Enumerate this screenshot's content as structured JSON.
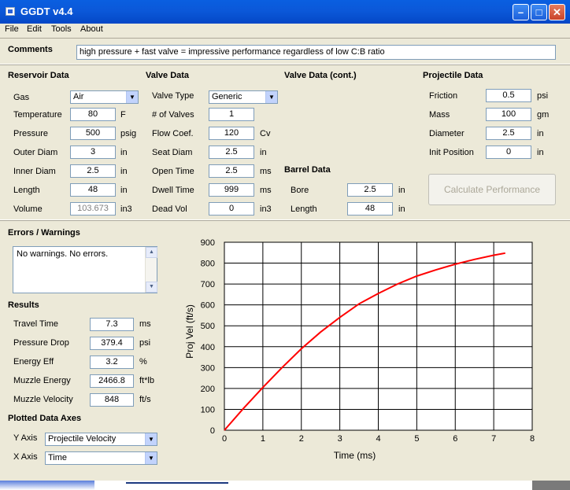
{
  "window": {
    "title": "GGDT v4.4"
  },
  "menu": [
    "File",
    "Edit",
    "Tools",
    "About"
  ],
  "comments": {
    "label": "Comments",
    "value": "high pressure + fast valve = impressive performance regardless of low C:B ratio"
  },
  "reservoir": {
    "title": "Reservoir Data",
    "gas_label": "Gas",
    "gas_value": "Air",
    "temperature_label": "Temperature",
    "temperature_value": "80",
    "temperature_unit": "F",
    "pressure_label": "Pressure",
    "pressure_value": "500",
    "pressure_unit": "psig",
    "outer_label": "Outer Diam",
    "outer_value": "3",
    "outer_unit": "in",
    "inner_label": "Inner Diam",
    "inner_value": "2.5",
    "inner_unit": "in",
    "length_label": "Length",
    "length_value": "48",
    "length_unit": "in",
    "volume_label": "Volume",
    "volume_value": "103.673",
    "volume_unit": "in3"
  },
  "valve": {
    "title": "Valve Data",
    "type_label": "Valve Type",
    "type_value": "Generic",
    "count_label": "# of Valves",
    "count_value": "1",
    "flow_label": "Flow Coef.",
    "flow_value": "120",
    "flow_unit": "Cv",
    "seat_label": "Seat Diam",
    "seat_value": "2.5",
    "seat_unit": "in",
    "open_label": "Open Time",
    "open_value": "2.5",
    "open_unit": "ms",
    "dwell_label": "Dwell Time",
    "dwell_value": "999",
    "dwell_unit": "ms",
    "dead_label": "Dead Vol",
    "dead_value": "0",
    "dead_unit": "in3"
  },
  "valve_cont": {
    "title": "Valve Data (cont.)"
  },
  "barrel": {
    "title": "Barrel Data",
    "bore_label": "Bore",
    "bore_value": "2.5",
    "bore_unit": "in",
    "length_label": "Length",
    "length_value": "48",
    "length_unit": "in"
  },
  "projectile": {
    "title": "Projectile Data",
    "friction_label": "Friction",
    "friction_value": "0.5",
    "friction_unit": "psi",
    "mass_label": "Mass",
    "mass_value": "100",
    "mass_unit": "gm",
    "diameter_label": "Diameter",
    "diameter_value": "2.5",
    "diameter_unit": "in",
    "init_label": "Init Position",
    "init_value": "0",
    "init_unit": "in"
  },
  "calculate_label": "Calculate Performance",
  "errors": {
    "title": "Errors / Warnings",
    "text": "No warnings.  No errors."
  },
  "results": {
    "title": "Results",
    "travel_label": "Travel Time",
    "travel_value": "7.3",
    "travel_unit": "ms",
    "drop_label": "Pressure Drop",
    "drop_value": "379.4",
    "drop_unit": "psi",
    "eff_label": "Energy Eff",
    "eff_value": "3.2",
    "eff_unit": "%",
    "energy_label": "Muzzle Energy",
    "energy_value": "2466.8",
    "energy_unit": "ft*lb",
    "velocity_label": "Muzzle Velocity",
    "velocity_value": "848",
    "velocity_unit": "ft/s"
  },
  "axes": {
    "title": "Plotted Data Axes",
    "y_label": "Y Axis",
    "y_value": "Projectile Velocity",
    "x_label": "X Axis",
    "x_value": "Time"
  },
  "chart_data": {
    "type": "line",
    "xlabel": "Time (ms)",
    "ylabel": "Proj Vel (ft/s)",
    "xlim": [
      0,
      8
    ],
    "ylim": [
      0,
      900
    ],
    "xticks": [
      0,
      1,
      2,
      3,
      4,
      5,
      6,
      7,
      8
    ],
    "yticks": [
      0,
      100,
      200,
      300,
      400,
      500,
      600,
      700,
      800,
      900
    ],
    "grid": true,
    "series": [
      {
        "color": "#ff0000",
        "x": [
          0,
          0.5,
          1,
          1.5,
          2,
          2.5,
          3,
          3.5,
          4,
          4.5,
          5,
          5.5,
          6,
          6.5,
          7,
          7.3
        ],
        "y": [
          0,
          105,
          205,
          300,
          390,
          470,
          540,
          605,
          655,
          700,
          738,
          768,
          795,
          818,
          838,
          848
        ]
      }
    ]
  }
}
